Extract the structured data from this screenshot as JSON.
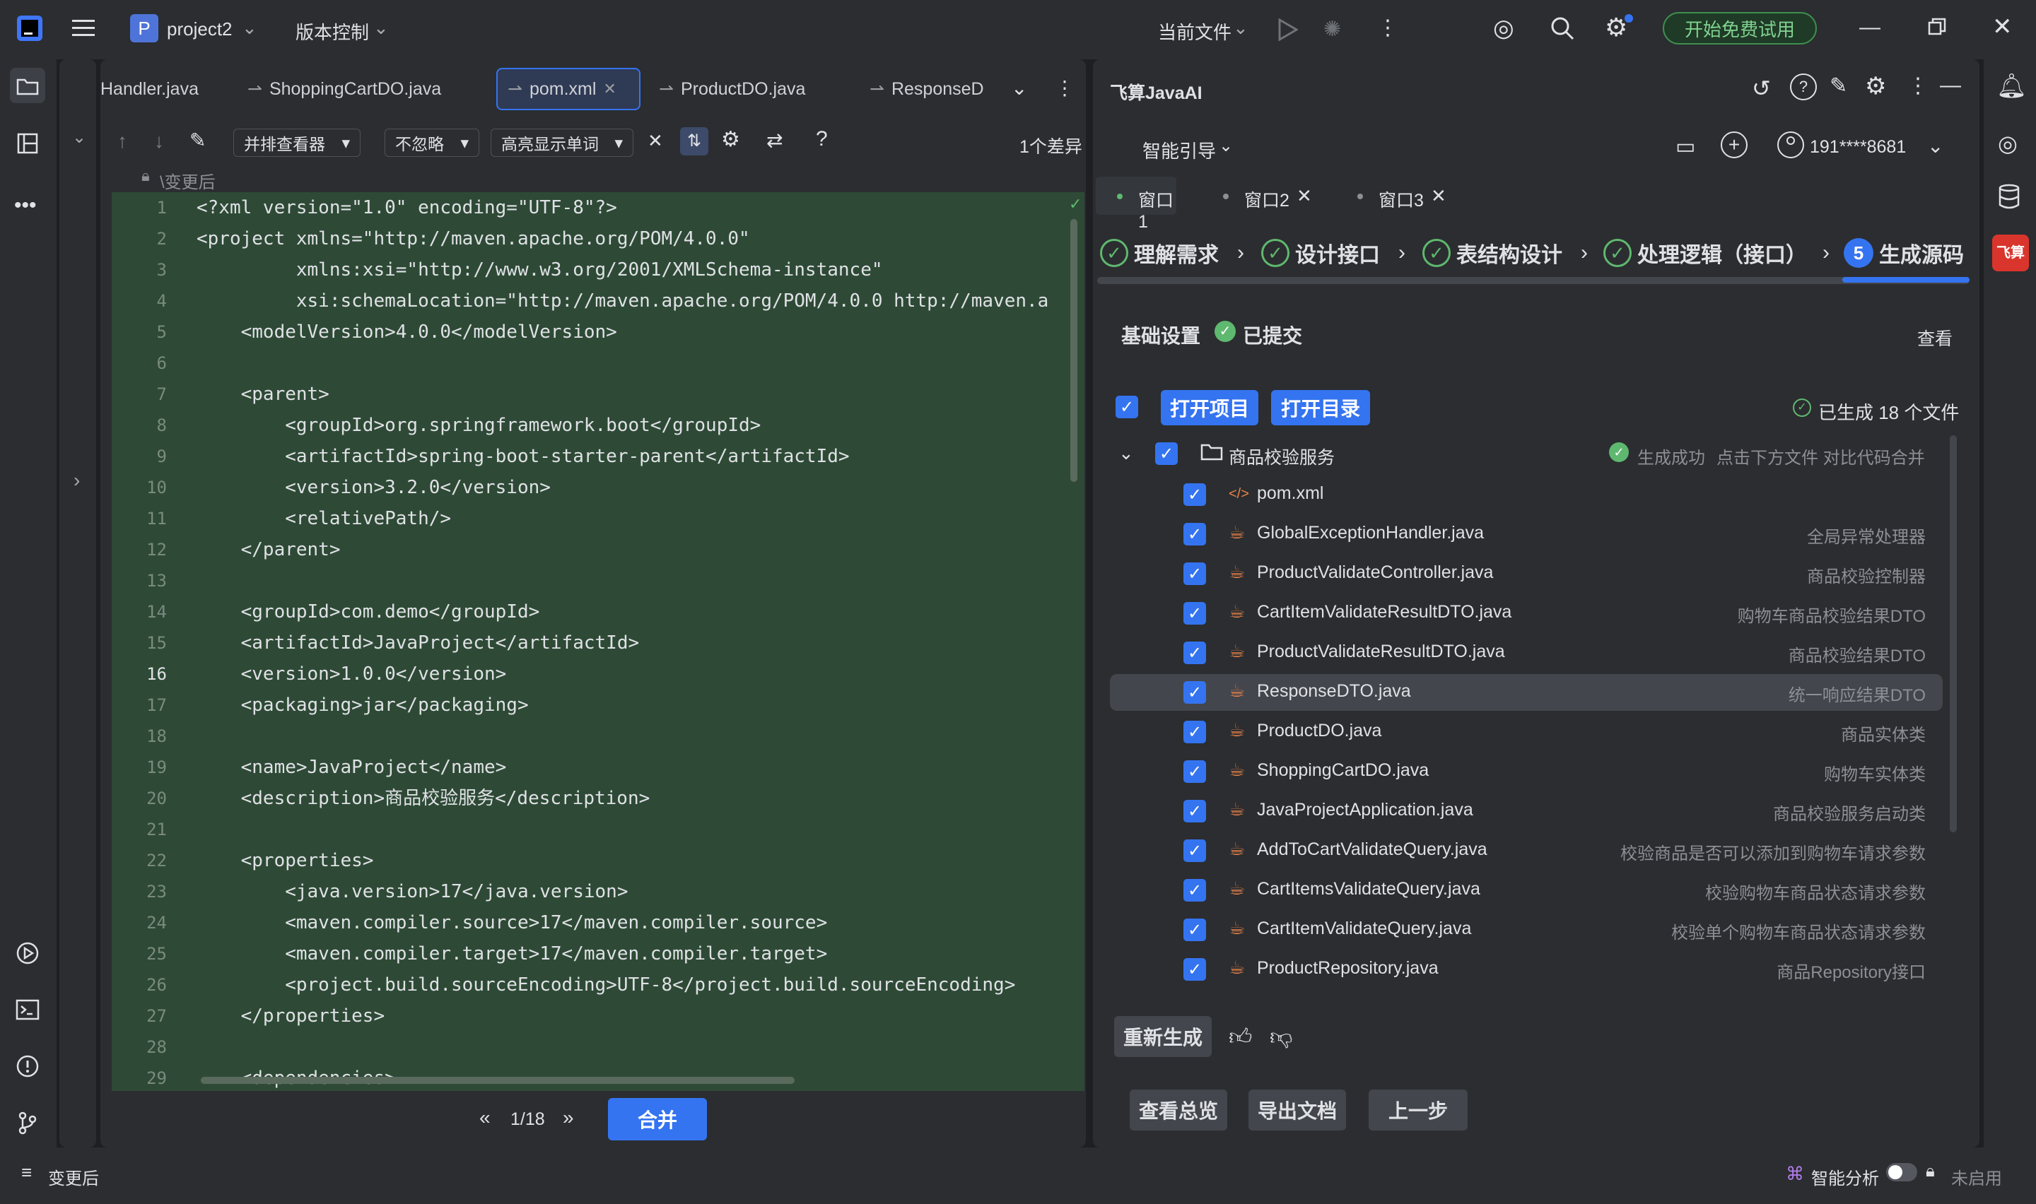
{
  "titlebar": {
    "project_badge": "P",
    "project_name": "project2",
    "vcs_menu": "版本控制",
    "current_file": "当前文件",
    "trial_button": "开始免费试用"
  },
  "editor": {
    "tabs": [
      {
        "label": "Handler.java"
      },
      {
        "label": "ShoppingCartDO.java"
      },
      {
        "label": "pom.xml"
      },
      {
        "label": "ProductDO.java"
      },
      {
        "label": "ResponseD"
      }
    ],
    "toolbar": {
      "viewer": "并排查看器",
      "ignore": "不忽略",
      "highlight": "高亮显示单词",
      "help": "?",
      "diff_count": "1个差异"
    },
    "readonly_label": "\\变更后",
    "lines": [
      {
        "n": "1",
        "text": "<?xml version=\"1.0\" encoding=\"UTF-8\"?>"
      },
      {
        "n": "2",
        "text": "<project xmlns=\"http://maven.apache.org/POM/4.0.0\""
      },
      {
        "n": "3",
        "text": "         xmlns:xsi=\"http://www.w3.org/2001/XMLSchema-instance\""
      },
      {
        "n": "4",
        "text": "         xsi:schemaLocation=\"http://maven.apache.org/POM/4.0.0 http://maven.a"
      },
      {
        "n": "5",
        "text": "    <modelVersion>4.0.0</modelVersion>"
      },
      {
        "n": "6",
        "text": ""
      },
      {
        "n": "7",
        "text": "    <parent>"
      },
      {
        "n": "8",
        "text": "        <groupId>org.springframework.boot</groupId>"
      },
      {
        "n": "9",
        "text": "        <artifactId>spring-boot-starter-parent</artifactId>"
      },
      {
        "n": "10",
        "text": "        <version>3.2.0</version>"
      },
      {
        "n": "11",
        "text": "        <relativePath/>"
      },
      {
        "n": "12",
        "text": "    </parent>"
      },
      {
        "n": "13",
        "text": ""
      },
      {
        "n": "14",
        "text": "    <groupId>com.demo</groupId>"
      },
      {
        "n": "15",
        "text": "    <artifactId>JavaProject</artifactId>"
      },
      {
        "n": "16",
        "text": "    <version>1.0.0</version>"
      },
      {
        "n": "17",
        "text": "    <packaging>jar</packaging>"
      },
      {
        "n": "18",
        "text": ""
      },
      {
        "n": "19",
        "text": "    <name>JavaProject</name>"
      },
      {
        "n": "20",
        "text": "    <description>商品校验服务</description>"
      },
      {
        "n": "21",
        "text": ""
      },
      {
        "n": "22",
        "text": "    <properties>"
      },
      {
        "n": "23",
        "text": "        <java.version>17</java.version>"
      },
      {
        "n": "24",
        "text": "        <maven.compiler.source>17</maven.compiler.source>"
      },
      {
        "n": "25",
        "text": "        <maven.compiler.target>17</maven.compiler.target>"
      },
      {
        "n": "26",
        "text": "        <project.build.sourceEncoding>UTF-8</project.build.sourceEncoding>"
      },
      {
        "n": "27",
        "text": "    </properties>"
      },
      {
        "n": "28",
        "text": ""
      },
      {
        "n": "29",
        "text": "    <dependencies>"
      }
    ],
    "pager": "1/18",
    "merge_button": "合并"
  },
  "ai": {
    "title": "飞算JavaAI",
    "guide": "智能引导",
    "user": "191****8681",
    "windows": [
      "窗口1",
      "窗口2",
      "窗口3"
    ],
    "steps": [
      {
        "label": "理解需求"
      },
      {
        "label": "设计接口"
      },
      {
        "label": "表结构设计"
      },
      {
        "label": "处理逻辑（接口）"
      },
      {
        "num": "5",
        "label": "生成源码"
      }
    ],
    "basic_settings": "基础设置",
    "submitted": "已提交",
    "view": "查看",
    "open_project": "打开项目",
    "open_dir": "打开目录",
    "generated": "已生成 18 个文件",
    "folder": "商品校验服务",
    "folder_status": "生成成功",
    "folder_hint": "点击下方文件 对比代码合并",
    "files": [
      {
        "name": "pom.xml",
        "desc": ""
      },
      {
        "name": "GlobalExceptionHandler.java",
        "desc": "全局异常处理器"
      },
      {
        "name": "ProductValidateController.java",
        "desc": "商品校验控制器"
      },
      {
        "name": "CartItemValidateResultDTO.java",
        "desc": "购物车商品校验结果DTO"
      },
      {
        "name": "ProductValidateResultDTO.java",
        "desc": "商品校验结果DTO"
      },
      {
        "name": "ResponseDTO.java",
        "desc": "统一响应结果DTO"
      },
      {
        "name": "ProductDO.java",
        "desc": "商品实体类"
      },
      {
        "name": "ShoppingCartDO.java",
        "desc": "购物车实体类"
      },
      {
        "name": "JavaProjectApplication.java",
        "desc": "商品校验服务启动类"
      },
      {
        "name": "AddToCartValidateQuery.java",
        "desc": "校验商品是否可以添加到购物车请求参数"
      },
      {
        "name": "CartItemsValidateQuery.java",
        "desc": "校验购物车商品状态请求参数"
      },
      {
        "name": "CartItemValidateQuery.java",
        "desc": "校验单个购物车商品状态请求参数"
      },
      {
        "name": "ProductRepository.java",
        "desc": "商品Repository接口"
      }
    ],
    "regenerate": "重新生成",
    "view_overview": "查看总览",
    "export_doc": "导出文档",
    "prev_step": "上一步"
  },
  "rightstrip": {
    "badge": "飞算"
  },
  "status": {
    "left": "变更后",
    "analysis": "智能分析",
    "disabled": "未启用"
  },
  "colors": {
    "accent": "#3574f0",
    "success": "#5fb86f",
    "diff_bg": "#2e4a36"
  }
}
